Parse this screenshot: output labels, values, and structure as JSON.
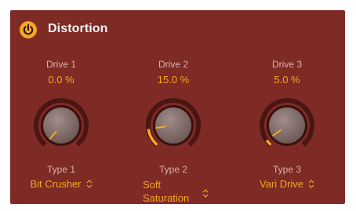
{
  "plugin": {
    "title": "Distortion",
    "power_on": true,
    "accent": "#f5a623",
    "background": "#7e2a25"
  },
  "stages": [
    {
      "drive_label": "Drive 1",
      "drive_value": "0.0 %",
      "drive_fraction": 0.0,
      "type_label": "Type 1",
      "type_value": "Bit Crusher"
    },
    {
      "drive_label": "Drive 2",
      "drive_value": "15.0 %",
      "drive_fraction": 0.15,
      "type_label": "Type 2",
      "type_value": "Soft Saturation"
    },
    {
      "drive_label": "Drive 3",
      "drive_value": "5.0 %",
      "drive_fraction": 0.05,
      "type_label": "Type 3",
      "type_value": "Vari Drive"
    }
  ]
}
